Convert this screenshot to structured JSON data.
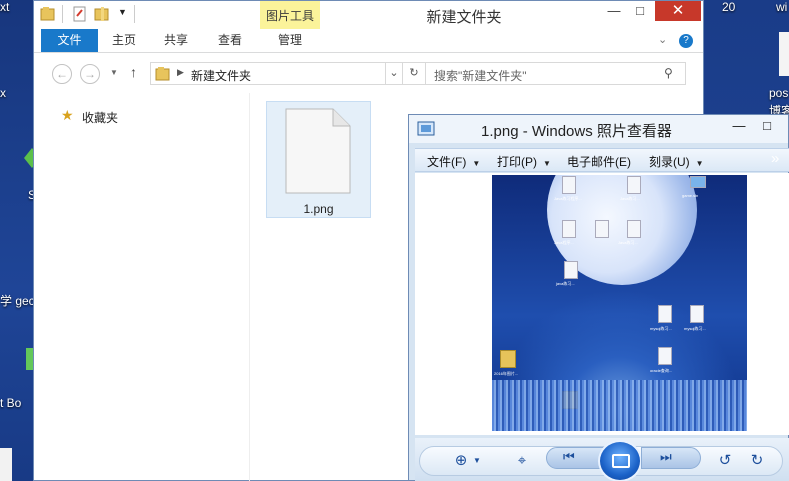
{
  "desktop": {
    "left_labels": [
      "xt",
      "x",
      "S",
      "学  gec",
      "t   Bo"
    ],
    "right_labels": [
      "20",
      "wi",
      "pos",
      "博客"
    ]
  },
  "explorer": {
    "title": "新建文件夹",
    "context_tab": "图片工具",
    "ribbon_tabs": [
      "文件",
      "主页",
      "共享",
      "查看",
      "管理"
    ],
    "address": "新建文件夹",
    "search_placeholder": "搜索\"新建文件夹\"",
    "nav": {
      "favorites": "收藏夹"
    },
    "files": [
      {
        "name": "1.png"
      }
    ],
    "controls": {
      "minimize": "—",
      "maximize": "□",
      "close": "✕"
    }
  },
  "viewer": {
    "title": "1.png - Windows 照片查看器",
    "menu": [
      "文件(F)",
      "打印(P)",
      "电子邮件(E)",
      "刻录(U)"
    ],
    "overflow": "»",
    "photo_icon_labels": [
      "Java练习程序...",
      "Java练习...",
      "game.sln",
      "Java程序...",
      "Java练习...",
      "java练习...",
      "mysql练习...",
      "mysql练习...",
      "2016年图片...",
      "oracle查询..."
    ]
  }
}
